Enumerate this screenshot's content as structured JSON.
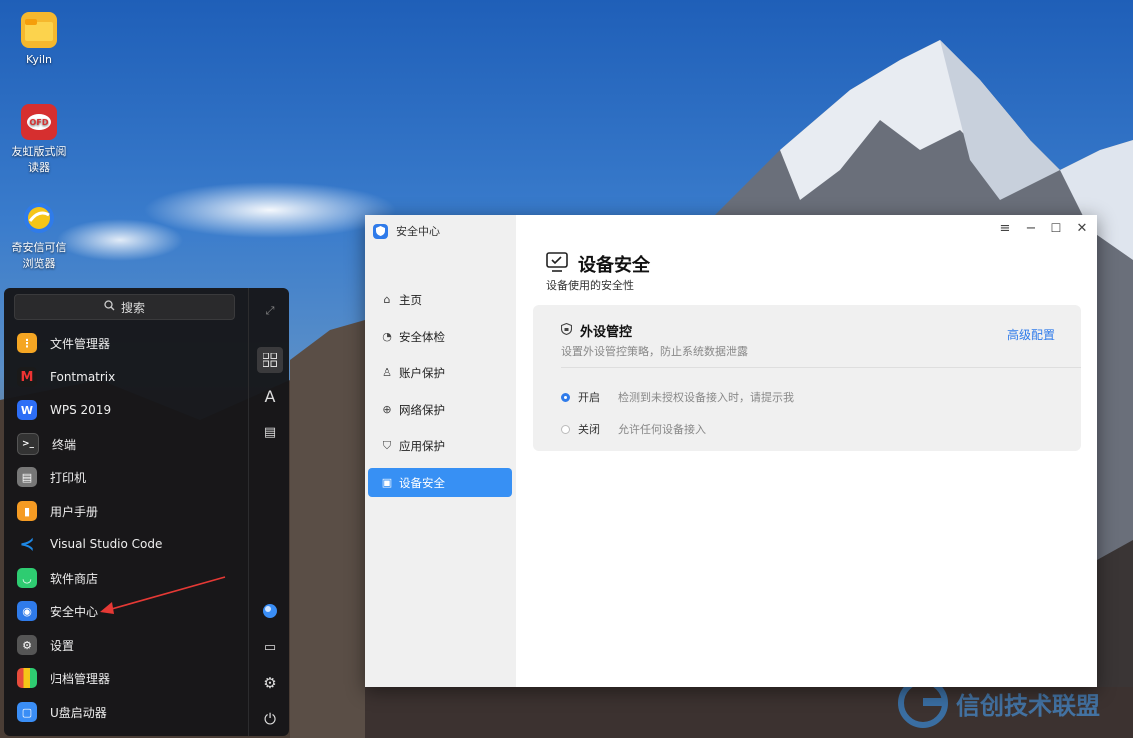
{
  "desktop": {
    "icons": [
      {
        "label": "Kyiln",
        "icon": "folder-icon"
      },
      {
        "label": "友虹版式阅读器",
        "icon": "ofd-reader-icon"
      },
      {
        "label": "奇安信可信浏览器",
        "icon": "browser-icon"
      }
    ],
    "watermark": "信创技术联盟"
  },
  "start_menu": {
    "search_label": "搜索",
    "apps": [
      {
        "label": "文件管理器",
        "color": "#f5a623"
      },
      {
        "label": "Fontmatrix",
        "color": "#1a1a1a"
      },
      {
        "label": "WPS 2019",
        "color": "#2d6ef6"
      },
      {
        "label": "终端",
        "color": "#333333"
      },
      {
        "label": "打印机",
        "color": "#666666"
      },
      {
        "label": "用户手册",
        "color": "#f59b23"
      },
      {
        "label": "Visual Studio Code",
        "color": "#1e88e5"
      },
      {
        "label": "软件商店",
        "color": "#2ecc71"
      },
      {
        "label": "安全中心",
        "color": "#2f7bea"
      },
      {
        "label": "设置",
        "color": "#555555"
      },
      {
        "label": "归档管理器",
        "color": "#e74c3c"
      },
      {
        "label": "U盘启动器",
        "color": "#3a8ef6"
      }
    ]
  },
  "window": {
    "title": "安全中心",
    "nav": [
      {
        "label": "主页",
        "icon": "home-icon"
      },
      {
        "label": "安全体检",
        "icon": "scan-icon"
      },
      {
        "label": "账户保护",
        "icon": "user-icon"
      },
      {
        "label": "网络保护",
        "icon": "globe-icon"
      },
      {
        "label": "应用保护",
        "icon": "shield-icon"
      },
      {
        "label": "设备安全",
        "icon": "device-icon"
      }
    ],
    "page_title": "设备安全",
    "page_subtitle": "设备使用的安全性",
    "card": {
      "title": "外设管控",
      "link": "高级配置",
      "description": "设置外设管控策略，防止系统数据泄露",
      "options": [
        {
          "label": "开启",
          "hint": "检测到未授权设备接入时，请提示我",
          "selected": true
        },
        {
          "label": "关闭",
          "hint": "允许任何设备接入",
          "selected": false
        }
      ]
    }
  }
}
